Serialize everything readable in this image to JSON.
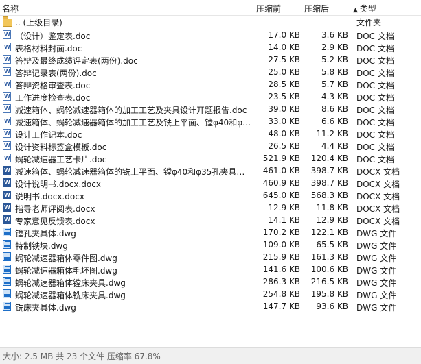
{
  "header": {
    "name": "名称",
    "orig_size": "压缩前",
    "comp_size": "压缩后",
    "type": "类型",
    "sort_arrow": "▲"
  },
  "files": [
    {
      "name": ".. (上级目录)",
      "orig": "",
      "comp": "",
      "type": "文件夹",
      "icon": "folder-icon",
      "kind": "folder"
    },
    {
      "name": "（设计）鉴定表.doc",
      "orig": "17.0 KB",
      "comp": "3.6 KB",
      "type": "DOC 文档",
      "icon": "doc-icon",
      "kind": "doc"
    },
    {
      "name": "表格材料封面.doc",
      "orig": "14.0 KB",
      "comp": "2.9 KB",
      "type": "DOC 文档",
      "icon": "doc-icon",
      "kind": "doc"
    },
    {
      "name": "答辩及最终成绩评定表(两份).doc",
      "orig": "27.5 KB",
      "comp": "5.2 KB",
      "type": "DOC 文档",
      "icon": "doc-icon",
      "kind": "doc"
    },
    {
      "name": "答辩记录表(两份).doc",
      "orig": "25.0 KB",
      "comp": "5.8 KB",
      "type": "DOC 文档",
      "icon": "doc-icon",
      "kind": "doc"
    },
    {
      "name": "答辩资格审查表.doc",
      "orig": "28.5 KB",
      "comp": "5.7 KB",
      "type": "DOC 文档",
      "icon": "doc-icon",
      "kind": "doc"
    },
    {
      "name": "工作进度检查表.doc",
      "orig": "23.5 KB",
      "comp": "4.3 KB",
      "type": "DOC 文档",
      "icon": "doc-icon",
      "kind": "doc"
    },
    {
      "name": "减速箱体、蜗轮减速器箱体的加工工艺及夹具设计开题报告.doc",
      "orig": "39.0 KB",
      "comp": "8.6 KB",
      "type": "DOC 文档",
      "icon": "doc-icon",
      "kind": "doc"
    },
    {
      "name": "减速箱体、蜗轮减速器箱体的加工工艺及铣上平面、镗φ40和φ3...",
      "orig": "33.0 KB",
      "comp": "6.6 KB",
      "type": "DOC 文档",
      "icon": "doc-icon",
      "kind": "doc"
    },
    {
      "name": "设计工作记本.doc",
      "orig": "48.0 KB",
      "comp": "11.2 KB",
      "type": "DOC 文档",
      "icon": "doc-icon",
      "kind": "doc"
    },
    {
      "name": "设计资料标签盒模板.doc",
      "orig": "26.5 KB",
      "comp": "4.4 KB",
      "type": "DOC 文档",
      "icon": "doc-icon",
      "kind": "doc"
    },
    {
      "name": "蜗轮减速器工艺卡片.doc",
      "orig": "521.9 KB",
      "comp": "120.4 KB",
      "type": "DOC 文档",
      "icon": "doc-icon",
      "kind": "doc"
    },
    {
      "name": "减速箱体、蜗轮减速器箱体的铣上平面、镗φ40和φ35孔夹具设...",
      "orig": "461.0 KB",
      "comp": "398.7 KB",
      "type": "DOCX 文档",
      "icon": "docx-icon",
      "kind": "docx"
    },
    {
      "name": "设计说明书.docx.docx",
      "orig": "460.9 KB",
      "comp": "398.7 KB",
      "type": "DOCX 文档",
      "icon": "docx-icon",
      "kind": "docx"
    },
    {
      "name": "说明书.docx.docx",
      "orig": "645.0 KB",
      "comp": "568.3 KB",
      "type": "DOCX 文档",
      "icon": "docx-icon",
      "kind": "docx"
    },
    {
      "name": "指导老师评阅表.docx",
      "orig": "12.9 KB",
      "comp": "11.8 KB",
      "type": "DOCX 文档",
      "icon": "docx-icon",
      "kind": "docx"
    },
    {
      "name": "专家意见反馈表.docx",
      "orig": "14.1 KB",
      "comp": "12.9 KB",
      "type": "DOCX 文档",
      "icon": "docx-icon",
      "kind": "docx"
    },
    {
      "name": "镗孔夹具体.dwg",
      "orig": "170.2 KB",
      "comp": "122.1 KB",
      "type": "DWG 文件",
      "icon": "dwg-icon",
      "kind": "dwg"
    },
    {
      "name": "特制铁块.dwg",
      "orig": "109.0 KB",
      "comp": "65.5 KB",
      "type": "DWG 文件",
      "icon": "dwg-icon",
      "kind": "dwg"
    },
    {
      "name": "蜗轮减速器箱体零件图.dwg",
      "orig": "215.9 KB",
      "comp": "161.3 KB",
      "type": "DWG 文件",
      "icon": "dwg-icon",
      "kind": "dwg"
    },
    {
      "name": "蜗轮减速器箱体毛坯图.dwg",
      "orig": "141.6 KB",
      "comp": "100.6 KB",
      "type": "DWG 文件",
      "icon": "dwg-icon",
      "kind": "dwg"
    },
    {
      "name": "蜗轮减速器箱体镗床夹具.dwg",
      "orig": "286.3 KB",
      "comp": "216.5 KB",
      "type": "DWG 文件",
      "icon": "dwg-icon",
      "kind": "dwg"
    },
    {
      "name": "蜗轮减速器箱体铣床夹具.dwg",
      "orig": "254.8 KB",
      "comp": "195.8 KB",
      "type": "DWG 文件",
      "icon": "dwg-icon",
      "kind": "dwg"
    },
    {
      "name": "铣床夹具体.dwg",
      "orig": "147.7 KB",
      "comp": "93.6 KB",
      "type": "DWG 文件",
      "icon": "dwg-icon",
      "kind": "dwg"
    }
  ],
  "status": {
    "text": "大小: 2.5 MB 共 23 个文件 压缩率 67.8%"
  }
}
